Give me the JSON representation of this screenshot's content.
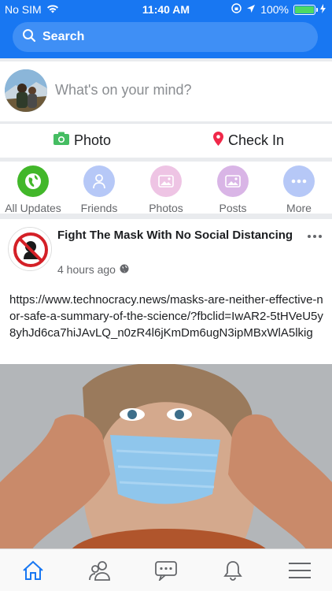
{
  "status_bar": {
    "carrier": "No SIM",
    "time": "11:40 AM",
    "battery_percent": "100%",
    "battery_level": 1.0,
    "battery_color": "#4cd964"
  },
  "header": {
    "search_label": "Search",
    "brand_color": "#1877f2"
  },
  "composer": {
    "prompt": "What's on your mind?"
  },
  "actions": {
    "photo_label": "Photo",
    "checkin_label": "Check In"
  },
  "filters": [
    {
      "label": "All Updates",
      "icon": "globe-icon",
      "color": "#42b72a"
    },
    {
      "label": "Friends",
      "icon": "person-icon",
      "color": "#b6c8f7"
    },
    {
      "label": "Photos",
      "icon": "photo-icon",
      "color": "#eec4e4"
    },
    {
      "label": "Posts",
      "icon": "image-icon",
      "color": "#d9b5e6"
    },
    {
      "label": "More",
      "icon": "more-icon",
      "color": "#b6c8f7"
    }
  ],
  "post": {
    "title": "Fight The Mask With No Social Distancing",
    "time": "4 hours ago",
    "text": "https://www.technocracy.news/masks-are-neither-effective-nor-safe-a-summary-of-the-science/?fbclid=IwAR2-5tHVeU5y8yhJd6ca7hiJAvLQ_n0zR4l6jKmDm6ugN3ipMBxWlA5lkig"
  },
  "tabbar": {
    "items": [
      "home-icon",
      "friends-icon",
      "messages-icon",
      "notifications-icon",
      "menu-icon"
    ],
    "active_color": "#1877f2"
  }
}
